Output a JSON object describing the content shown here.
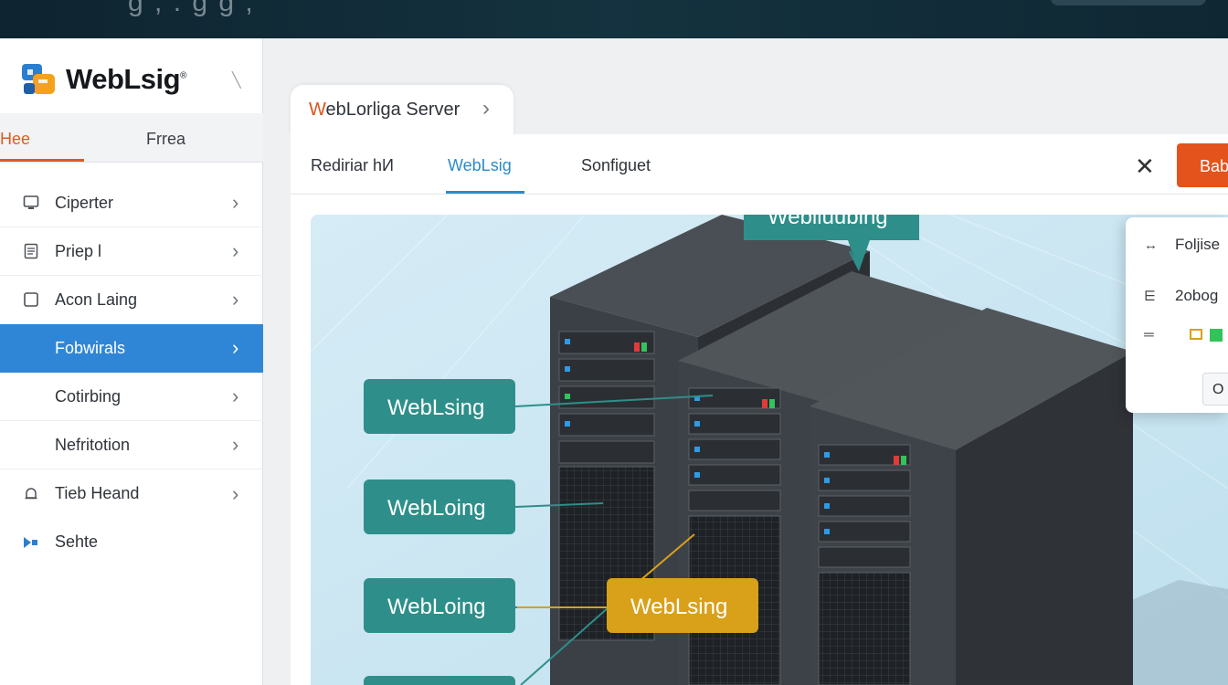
{
  "banner": {
    "ghost_text": "g ,       .   g  g ,"
  },
  "app": {
    "logo_text": "WebLsig",
    "logo_reg": "®"
  },
  "sidebar": {
    "tabs": [
      {
        "label": "Hee",
        "active": true
      },
      {
        "label": "Frrea",
        "active": false
      }
    ],
    "items": [
      {
        "label": "Ciperter",
        "icon": "monitor-icon"
      },
      {
        "label": "Priep l",
        "icon": "document-icon"
      },
      {
        "label": "Acon Laing",
        "icon": "square-icon"
      },
      {
        "label": "Fobwirals",
        "icon": "",
        "active": true
      },
      {
        "label": "Cotirbing",
        "icon": ""
      },
      {
        "label": "Nefritotion",
        "icon": ""
      },
      {
        "label": "Tieb Heand",
        "icon": "bell-icon"
      },
      {
        "label": "Sehte",
        "icon": "pointer-icon"
      }
    ]
  },
  "breadcrumb": {
    "first": "W",
    "rest": "ebLorliga  Server",
    "chevron": "›"
  },
  "tabs": [
    {
      "label": "Rediriar hИ",
      "active": false
    },
    {
      "label": "WebLsig",
      "active": true
    },
    {
      "label": "Sonfiguet",
      "active": false
    }
  ],
  "toolbar": {
    "close": "✕",
    "action_label": "Bab"
  },
  "illustration": {
    "top_banner": "Weblluubing",
    "labels": [
      "WebLsing",
      "WebLoing",
      "WebLoing",
      "WebLsing"
    ]
  },
  "popup": {
    "rows": [
      {
        "icon": "arrows-icon",
        "text": "Foljise"
      },
      {
        "icon": "sliders-icon",
        "text": "2obog"
      },
      {
        "icon": "menu-icon",
        "text": ""
      }
    ],
    "button": "O"
  },
  "colors": {
    "accent_orange": "#e5531c",
    "accent_blue": "#2f86d6",
    "teal": "#2e8f8a",
    "gold": "#d9a11a"
  }
}
